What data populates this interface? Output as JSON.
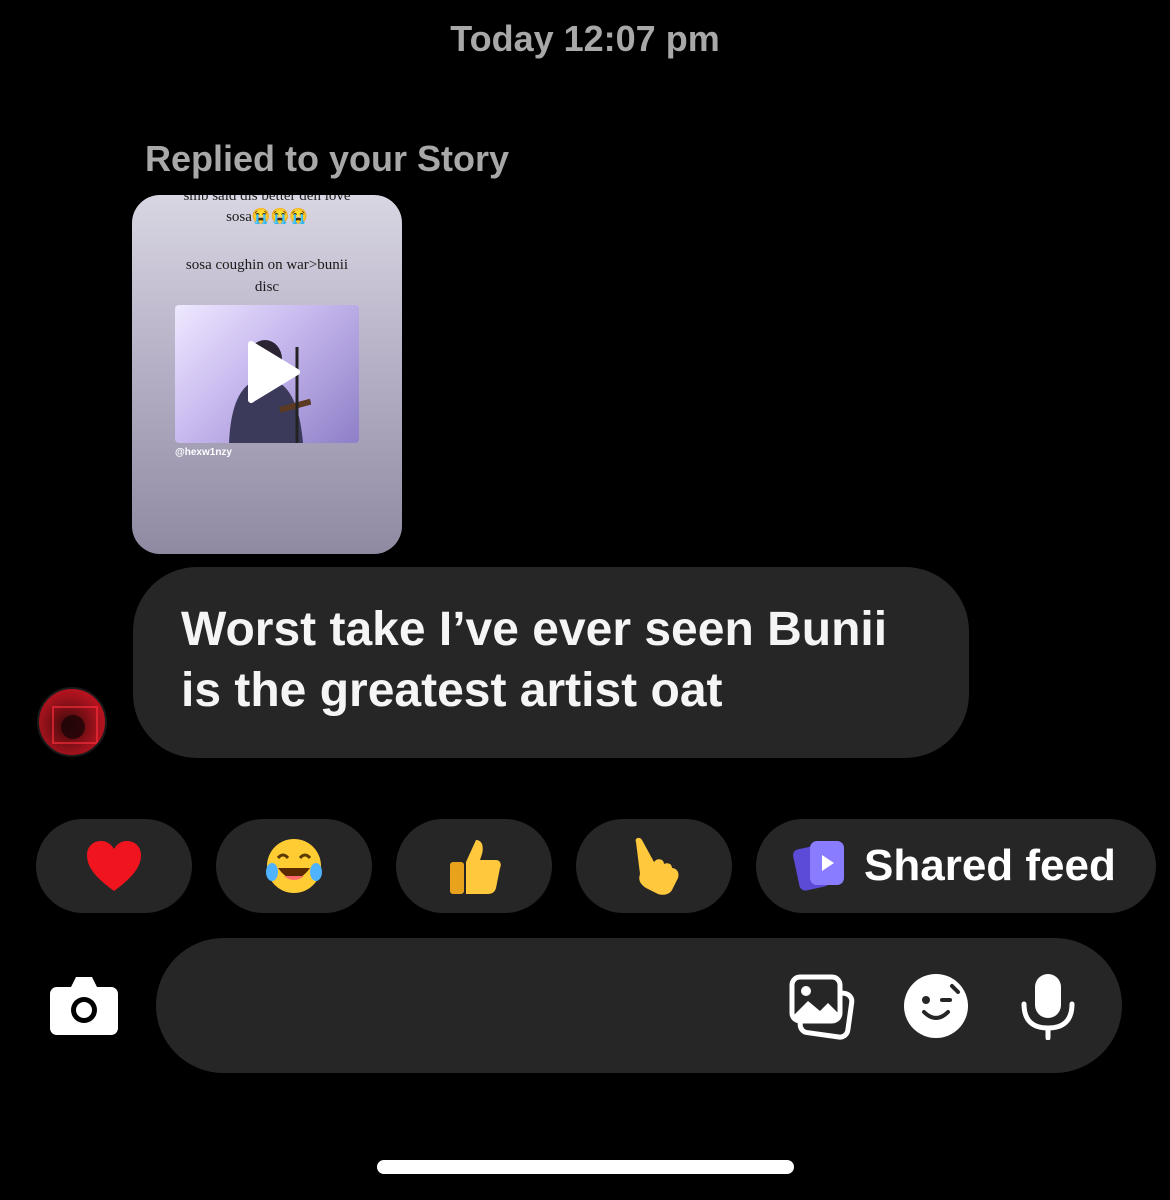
{
  "thread": {
    "timestamp": "Today 12:07 pm",
    "reply_context": "Replied to your Story"
  },
  "story": {
    "caption_line1": "smb said dis better den love",
    "caption_line2": "sosa😭😭😭",
    "caption_line3": "sosa coughin on war>bunii",
    "caption_line4": "disc",
    "handle": "@hexw1nzy"
  },
  "message": {
    "text_line1": "Worst take I’ve ever seen Bunii",
    "text_line2": "is the greatest artist oat"
  },
  "quick_reactions": [
    {
      "icon": "heart-icon",
      "glyph": "❤️"
    },
    {
      "icon": "laughing-tears-icon",
      "glyph": "😂"
    },
    {
      "icon": "thumbs-up-icon",
      "glyph": "👍"
    },
    {
      "icon": "pointing-hand-icon",
      "glyph": "👆"
    }
  ],
  "shared_feed": {
    "label": "Shared feed",
    "accent": "#7a6cf0"
  },
  "composer": {
    "placeholder": ""
  },
  "colors": {
    "background": "#000000",
    "bubble": "#262626",
    "muted_text": "#a8a8a8"
  }
}
